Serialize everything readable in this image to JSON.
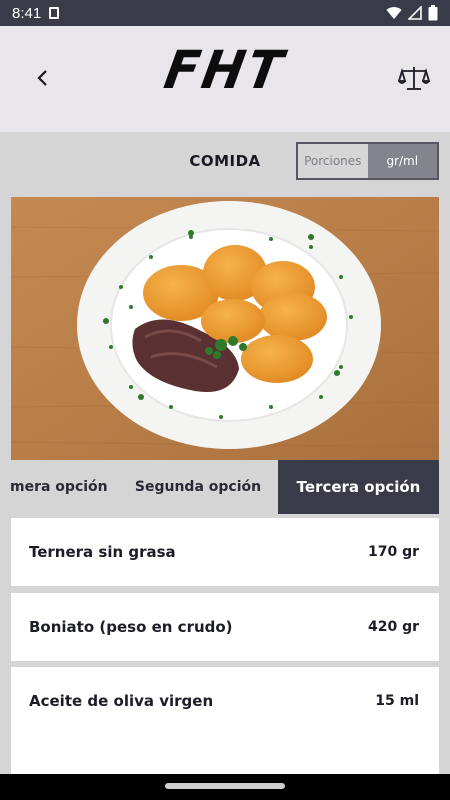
{
  "status_bar": {
    "time": "8:41",
    "icons": [
      "sd-card-icon",
      "wifi-icon",
      "signal-icon",
      "battery-icon"
    ]
  },
  "header": {
    "logo_text": "FHT",
    "back_icon": "chevron-left-icon",
    "scale_icon": "balance-scale-icon"
  },
  "section": {
    "title": "COMIDA"
  },
  "unit_toggle": {
    "options": [
      "Porciones",
      "gr/ml"
    ],
    "selected": "gr/ml"
  },
  "meal_photo": {
    "description_icon": "plate-photo"
  },
  "tabs": [
    {
      "label": "mera opción",
      "active": false
    },
    {
      "label": "Segunda opción",
      "active": false
    },
    {
      "label": "Tercera opción",
      "active": true
    }
  ],
  "ingredients": [
    {
      "name": "Ternera sin grasa",
      "amount": "170 gr"
    },
    {
      "name": "Boniato (peso en crudo)",
      "amount": "420 gr"
    },
    {
      "name": "Aceite de oliva virgen",
      "amount": "15 ml"
    }
  ],
  "colors": {
    "accent": "#3a3b48",
    "header_bg": "#e9e6eb",
    "content_bg": "#d5d5d5"
  }
}
